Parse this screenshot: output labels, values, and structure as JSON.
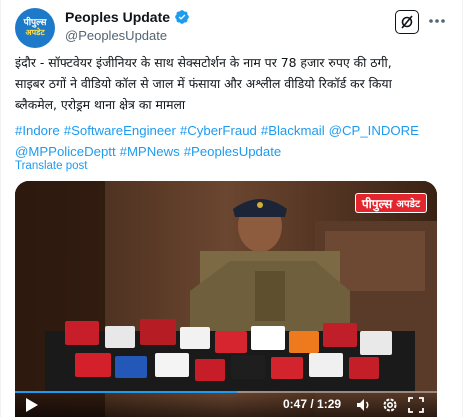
{
  "account": {
    "display_name": "Peoples Update",
    "handle": "@PeoplesUpdate",
    "avatar_text_1": "पीपुल्स",
    "avatar_text_2": "अपडेट"
  },
  "tweet": {
    "text_line1": "इंदौर - सॉफ्टवेयर इंजीनियर के साथ सेक्सटोर्शन के नाम पर 78 हजार रुपए की ठगी,",
    "text_line2": "साइबर ठगों ने वीडियो कॉल से जाल में फंसाया और अश्लील वीडियो रिकॉर्ड कर किया",
    "text_line3": "ब्लैकमेल, एरोड्रम थाना क्षेत्र का मामला",
    "hashtags": [
      "#Indore",
      "#SoftwareEngineer",
      "#CyberFraud",
      "#Blackmail",
      "@CP_INDORE",
      "@MPPoliceDeptt",
      "#MPNews",
      "#PeoplesUpdate"
    ],
    "translate_label": "Translate post"
  },
  "video": {
    "watermark_main": "पीपुल्स",
    "watermark_sub": "अपडेट",
    "time_display": "0:47 / 1:29",
    "progress_fraction": 0.527
  },
  "colors": {
    "link": "#1d9bf0",
    "verified": "#1d9bf0",
    "watermark_bg": "#e3262d"
  }
}
